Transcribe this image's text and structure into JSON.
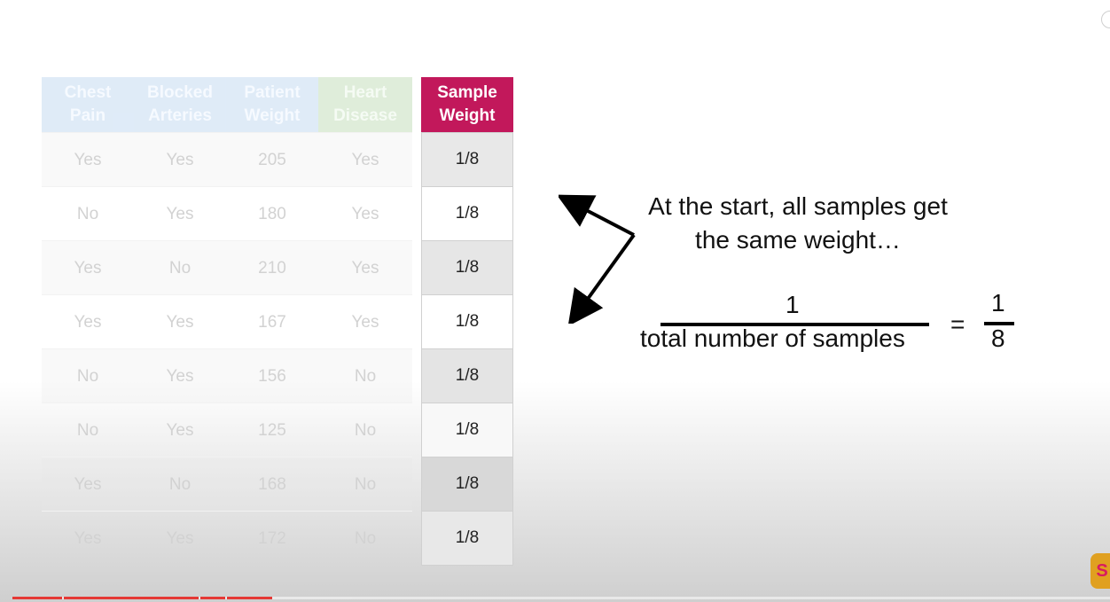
{
  "table": {
    "headers": [
      "Chest\nPain",
      "Blocked\nArteries",
      "Patient\nWeight",
      "Heart\nDisease"
    ],
    "rows": [
      [
        "Yes",
        "Yes",
        "205",
        "Yes"
      ],
      [
        "No",
        "Yes",
        "180",
        "Yes"
      ],
      [
        "Yes",
        "No",
        "210",
        "Yes"
      ],
      [
        "Yes",
        "Yes",
        "167",
        "Yes"
      ],
      [
        "No",
        "Yes",
        "156",
        "No"
      ],
      [
        "No",
        "Yes",
        "125",
        "No"
      ],
      [
        "Yes",
        "No",
        "168",
        "No"
      ],
      [
        "Yes",
        "Yes",
        "172",
        "No"
      ]
    ]
  },
  "weights": {
    "header": "Sample\nWeight",
    "values": [
      "1/8",
      "1/8",
      "1/8",
      "1/8",
      "1/8",
      "1/8",
      "1/8",
      "1/8"
    ]
  },
  "explanation": {
    "line1": "At the start, all samples get",
    "line2": "the same weight…",
    "numerator": "1",
    "denominator": "total number of samples",
    "equals": "=",
    "result_num": "1",
    "result_den": "8"
  },
  "colors": {
    "weight_header": "#c2185b",
    "progress_played": "#e53935"
  },
  "player": {
    "progress": 0.24
  },
  "icons": {
    "channel_logo": "statquest-logo",
    "corner": "circle-icon"
  }
}
